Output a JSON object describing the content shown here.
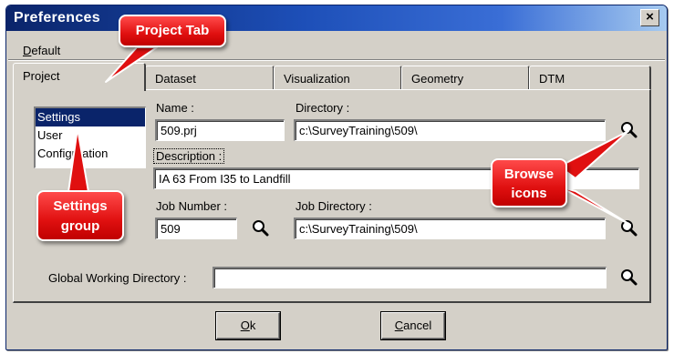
{
  "window": {
    "title": "Preferences",
    "close_glyph": "×"
  },
  "menu": {
    "default_first": "D",
    "default_rest": "efault"
  },
  "tabs": [
    {
      "label": "Project",
      "active": true
    },
    {
      "label": "Dataset"
    },
    {
      "label": "Visualization"
    },
    {
      "label": "Geometry"
    },
    {
      "label": "DTM"
    }
  ],
  "settings_list": [
    "Settings",
    "User",
    "Configuration"
  ],
  "fields": {
    "name_label": "Name :",
    "name_value": "509.prj",
    "directory_label": "Directory :",
    "directory_value": "c:\\SurveyTraining\\509\\",
    "description_label": "Description :",
    "description_value": "IA 63 From I35 to Landfill",
    "job_number_label": "Job Number :",
    "job_number_value": "509",
    "job_directory_label": "Job Directory :",
    "job_directory_value": "c:\\SurveyTraining\\509\\",
    "global_dir_label": "Global Working Directory :",
    "global_dir_value": ""
  },
  "buttons": {
    "ok_first": "O",
    "ok_rest": "k",
    "cancel_first": "C",
    "cancel_rest": "ancel"
  },
  "callouts": {
    "project_tab": "Project Tab",
    "settings_group_line1": "Settings",
    "settings_group_line2": "group",
    "browse_line1": "Browse",
    "browse_line2": "icons"
  },
  "icons": [
    "close-icon",
    "magnifier-icon"
  ],
  "colors": {
    "titlebar": "#0a246a",
    "callout": "#e01010",
    "selection": "#0a246a",
    "dialog": "#d4d0c8"
  }
}
